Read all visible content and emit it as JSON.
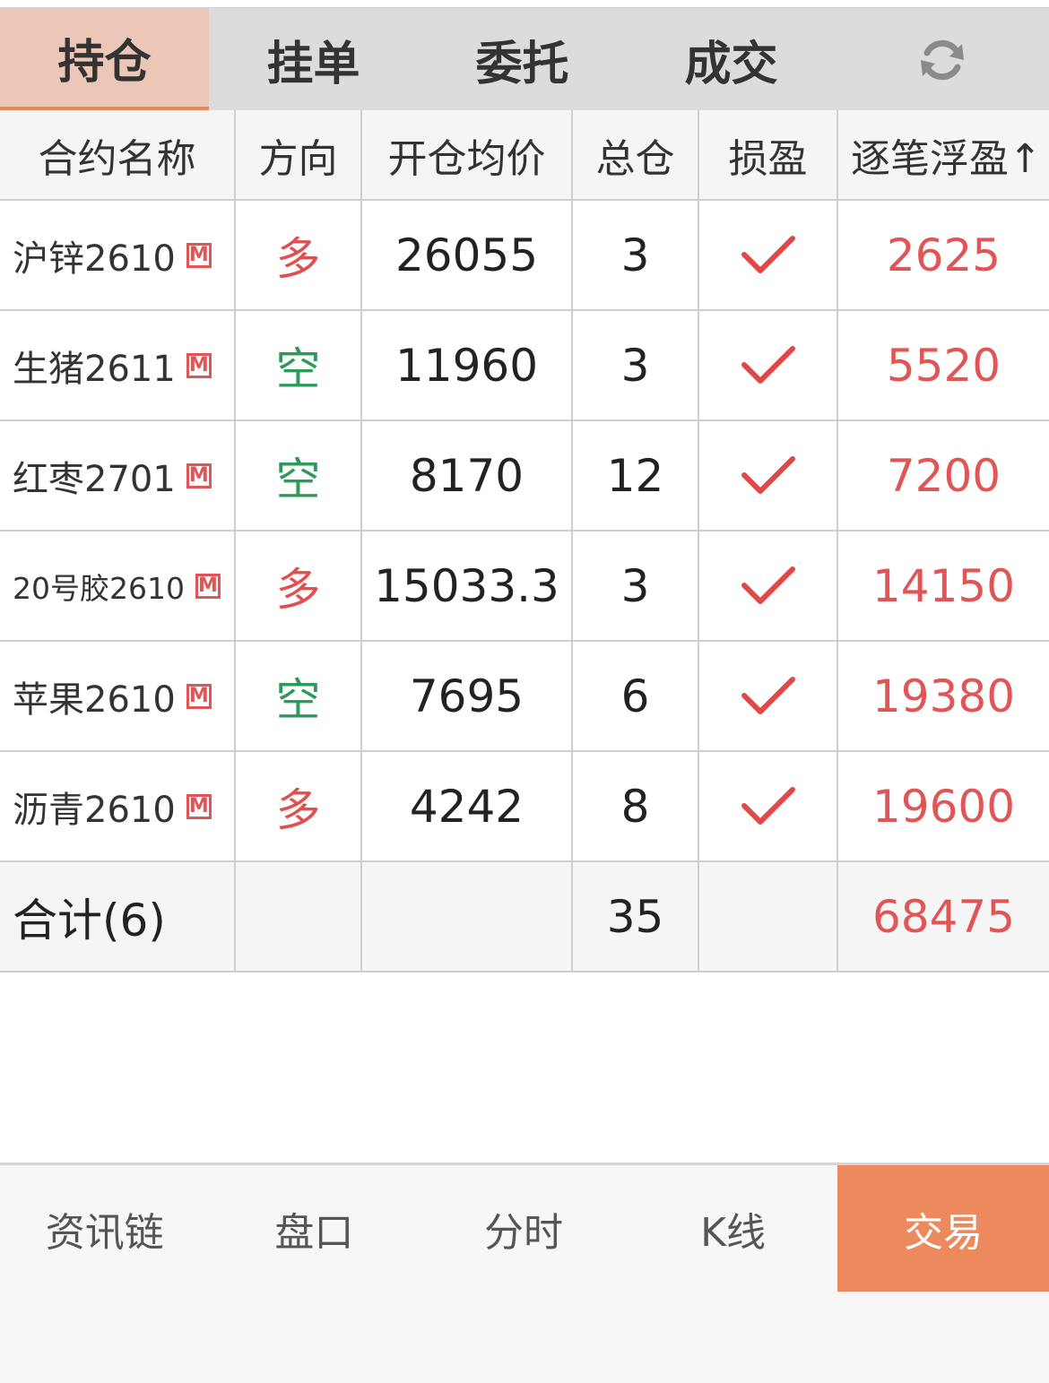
{
  "tabs": [
    {
      "label": "持仓",
      "active": true
    },
    {
      "label": "挂单",
      "active": false
    },
    {
      "label": "委托",
      "active": false
    },
    {
      "label": "成交",
      "active": false
    }
  ],
  "refresh_icon": "refresh-icon",
  "table": {
    "headers": [
      "合约名称",
      "方向",
      "开仓均价",
      "总仓",
      "损盈",
      "逐笔浮盈↑"
    ],
    "rows": [
      {
        "name": "沪锌2610",
        "badge": "M",
        "direction": "多",
        "direction_type": "long",
        "avg_price": "26055",
        "total": "3",
        "profit_check": "check-icon",
        "floating_pnl": "2625"
      },
      {
        "name": "生猪2611",
        "badge": "M",
        "direction": "空",
        "direction_type": "short",
        "avg_price": "11960",
        "total": "3",
        "profit_check": "check-icon",
        "floating_pnl": "5520"
      },
      {
        "name": "红枣2701",
        "badge": "M",
        "direction": "空",
        "direction_type": "short",
        "avg_price": "8170",
        "total": "12",
        "profit_check": "check-icon",
        "floating_pnl": "7200"
      },
      {
        "name": "20号胶2610",
        "badge": "M",
        "direction": "多",
        "direction_type": "long",
        "avg_price": "15033.3",
        "total": "3",
        "profit_check": "check-icon",
        "floating_pnl": "14150"
      },
      {
        "name": "苹果2610",
        "badge": "M",
        "direction": "空",
        "direction_type": "short",
        "avg_price": "7695",
        "total": "6",
        "profit_check": "check-icon",
        "floating_pnl": "19380"
      },
      {
        "name": "沥青2610",
        "badge": "M",
        "direction": "多",
        "direction_type": "long",
        "avg_price": "4242",
        "total": "8",
        "profit_check": "check-icon",
        "floating_pnl": "19600"
      }
    ],
    "total": {
      "label": "合计(6)",
      "total_positions": "35",
      "floating_pnl": "68475"
    }
  },
  "bottom_nav": [
    {
      "label": "资讯链",
      "active": false
    },
    {
      "label": "盘口",
      "active": false
    },
    {
      "label": "分时",
      "active": false
    },
    {
      "label": "K线",
      "active": false
    },
    {
      "label": "交易",
      "active": true
    }
  ],
  "colors": {
    "accent": "#ec8a5e",
    "active_tab_bg": "#ecc6b7",
    "long": "#e05050",
    "short": "#2e9a5a",
    "profit": "#e05555"
  }
}
